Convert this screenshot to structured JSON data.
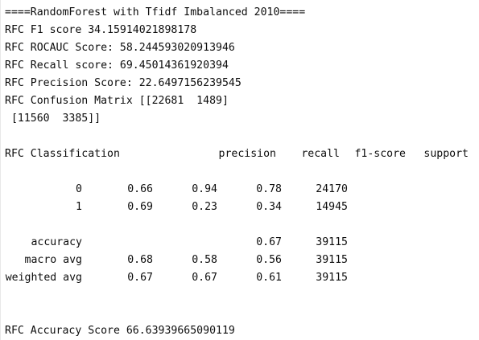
{
  "console": {
    "header": "====RandomForest with Tfidf Imbalanced 2010====",
    "f1": "RFC F1 score 34.15914021898178",
    "rocauc": "RFC ROCAUC Score: 58.244593020913946",
    "recall": "RFC Recall score: 69.45014361920394",
    "precision": "RFC Precision Score: 22.6497156239545",
    "cm_line1": "RFC Confusion Matrix [[22681  1489]",
    "cm_line2": " [11560  3385]]",
    "report_title": "RFC Classification",
    "columns": [
      "precision",
      "recall",
      "f1-score",
      "support"
    ],
    "rows": [
      {
        "label": "0",
        "values": [
          "0.66",
          "0.94",
          "0.78",
          "24170"
        ]
      },
      {
        "label": "1",
        "values": [
          "0.69",
          "0.23",
          "0.34",
          "14945"
        ]
      }
    ],
    "accuracy": {
      "label": "accuracy",
      "f1": "0.67",
      "support": "39115"
    },
    "macro": {
      "label": "macro avg",
      "values": [
        "0.68",
        "0.58",
        "0.56",
        "39115"
      ]
    },
    "weighted": {
      "label": "weighted avg",
      "values": [
        "0.67",
        "0.67",
        "0.61",
        "39115"
      ]
    },
    "accuracy_score": "RFC Accuracy Score 66.63939665090119"
  }
}
